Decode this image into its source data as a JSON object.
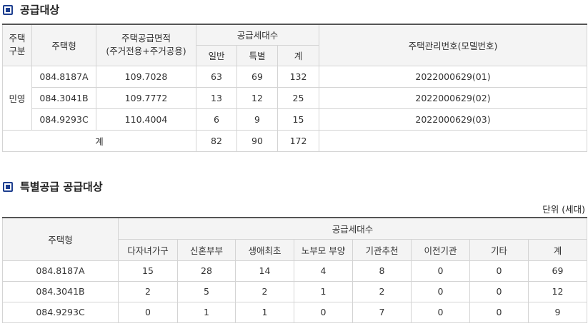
{
  "supply": {
    "title": "공급대상",
    "headers": {
      "housing_type": [
        "주택",
        "구분"
      ],
      "house_type": "주택형",
      "area": [
        "주택공급면적",
        "(주거전용+주거공용)"
      ],
      "households": "공급세대수",
      "general": "일반",
      "special": "특별",
      "total": "계",
      "mgmt_no": "주택관리번호(모델번호)"
    },
    "category": "민영",
    "rows": [
      {
        "type": "084.8187A",
        "area": "109.7028",
        "general": "63",
        "special": "69",
        "total": "132",
        "mgmt": "2022000629(01)"
      },
      {
        "type": "084.3041B",
        "area": "109.7772",
        "general": "13",
        "special": "12",
        "total": "25",
        "mgmt": "2022000629(02)"
      },
      {
        "type": "084.9293C",
        "area": "110.4004",
        "general": "6",
        "special": "9",
        "total": "15",
        "mgmt": "2022000629(03)"
      }
    ],
    "sum": {
      "label": "계",
      "general": "82",
      "special": "90",
      "total": "172"
    }
  },
  "special_supply": {
    "title": "특별공급 공급대상",
    "unit": "단위 (세대)",
    "headers": {
      "house_type": "주택형",
      "households": "공급세대수",
      "cols": [
        "다자녀가구",
        "신혼부부",
        "생애최초",
        "노부모 부양",
        "기관추천",
        "이전기관",
        "기타",
        "계"
      ]
    },
    "rows": [
      {
        "type": "084.8187A",
        "values": [
          "15",
          "28",
          "14",
          "4",
          "8",
          "0",
          "0",
          "69"
        ]
      },
      {
        "type": "084.3041B",
        "values": [
          "2",
          "5",
          "2",
          "1",
          "2",
          "0",
          "0",
          "12"
        ]
      },
      {
        "type": "084.9293C",
        "values": [
          "0",
          "1",
          "1",
          "0",
          "7",
          "0",
          "0",
          "9"
        ]
      }
    ]
  },
  "colors": {
    "accent": "#1e3f8f",
    "header_bg": "#f4f4f4",
    "border": "#d4d4d4",
    "top_border": "#555555"
  },
  "icons": {
    "section_marker": "square-bullet-icon"
  }
}
